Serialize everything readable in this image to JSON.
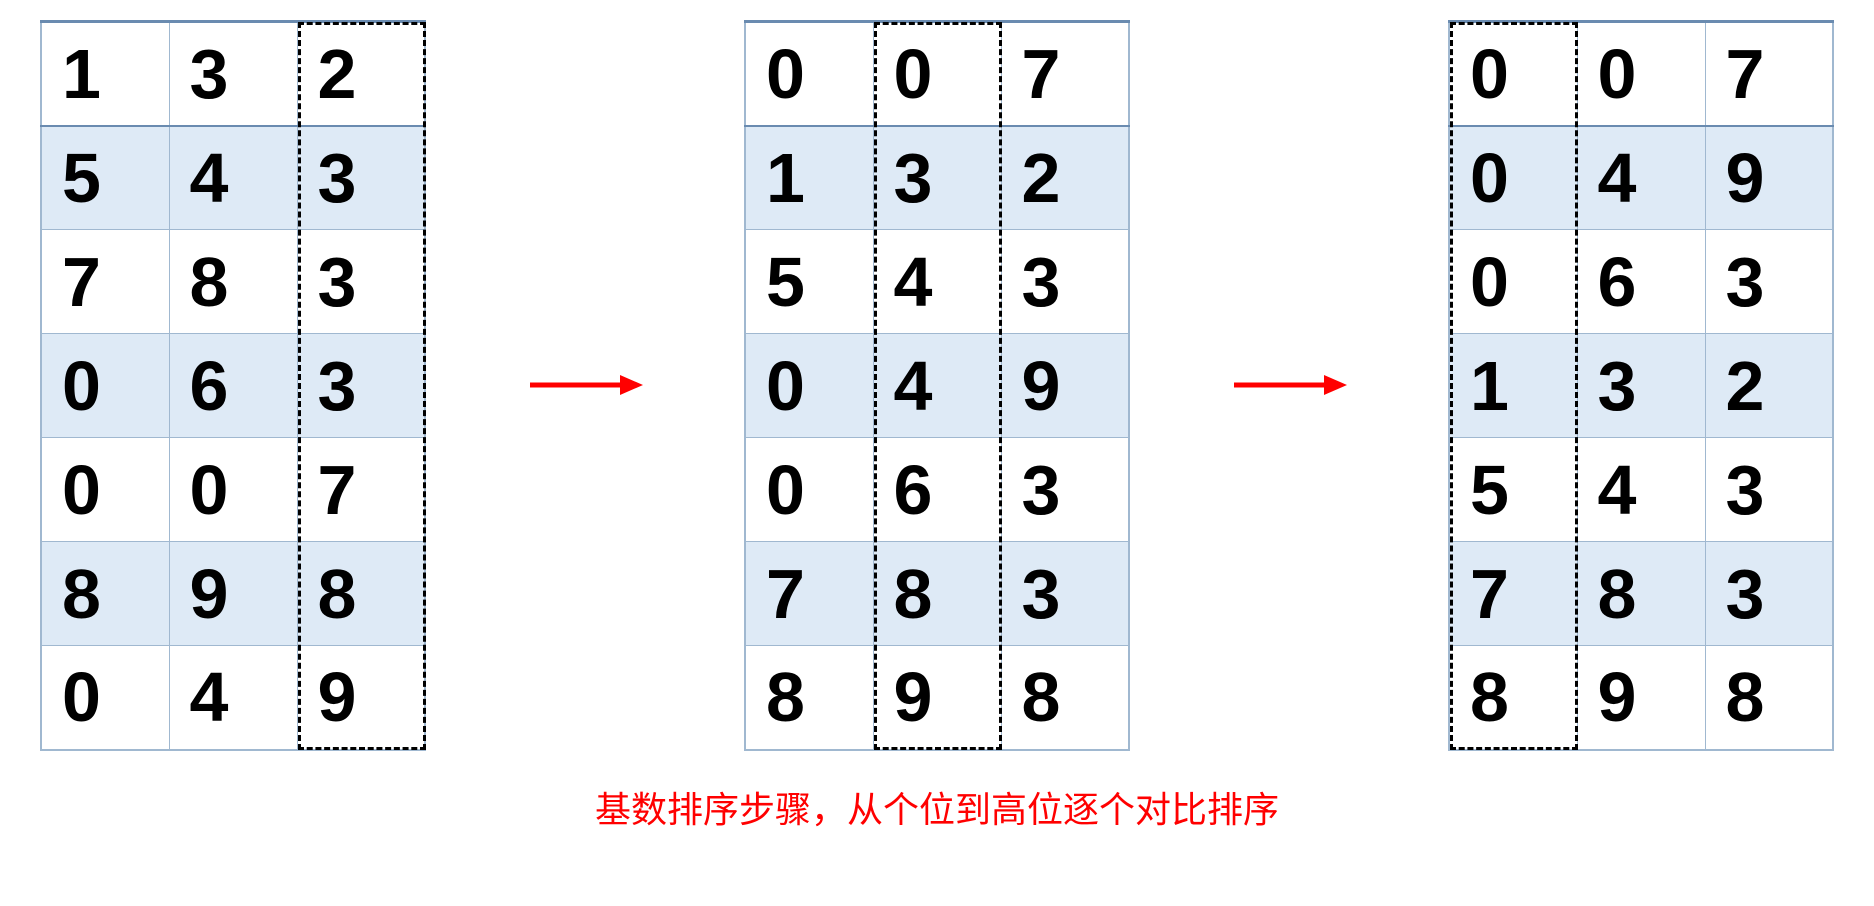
{
  "caption": "基数排序步骤，从个位到高位逐个对比排序",
  "tables": [
    {
      "highlightColumn": 2,
      "rows": [
        [
          "1",
          "3",
          "2"
        ],
        [
          "5",
          "4",
          "3"
        ],
        [
          "7",
          "8",
          "3"
        ],
        [
          "0",
          "6",
          "3"
        ],
        [
          "0",
          "0",
          "7"
        ],
        [
          "8",
          "9",
          "8"
        ],
        [
          "0",
          "4",
          "9"
        ]
      ]
    },
    {
      "highlightColumn": 1,
      "rows": [
        [
          "0",
          "0",
          "7"
        ],
        [
          "1",
          "3",
          "2"
        ],
        [
          "5",
          "4",
          "3"
        ],
        [
          "0",
          "4",
          "9"
        ],
        [
          "0",
          "6",
          "3"
        ],
        [
          "7",
          "8",
          "3"
        ],
        [
          "8",
          "9",
          "8"
        ]
      ]
    },
    {
      "highlightColumn": 0,
      "rows": [
        [
          "0",
          "0",
          "7"
        ],
        [
          "0",
          "4",
          "9"
        ],
        [
          "0",
          "6",
          "3"
        ],
        [
          "1",
          "3",
          "2"
        ],
        [
          "5",
          "4",
          "3"
        ],
        [
          "7",
          "8",
          "3"
        ],
        [
          "8",
          "9",
          "8"
        ]
      ]
    }
  ],
  "chart_data": {
    "type": "table",
    "title": "基数排序步骤，从个位到高位逐个对比排序",
    "description": "Radix sort steps, comparing and sorting digit by digit from ones place to higher places",
    "steps": [
      {
        "step": 1,
        "sort_digit": "ones (个位)",
        "highlight_column_index": 2,
        "numbers": [
          132,
          543,
          783,
          63,
          7,
          898,
          49
        ]
      },
      {
        "step": 2,
        "sort_digit": "tens (十位)",
        "highlight_column_index": 1,
        "numbers": [
          7,
          132,
          543,
          49,
          63,
          783,
          898
        ]
      },
      {
        "step": 3,
        "sort_digit": "hundreds (百位)",
        "highlight_column_index": 0,
        "numbers": [
          7,
          49,
          63,
          132,
          543,
          783,
          898
        ]
      }
    ]
  }
}
